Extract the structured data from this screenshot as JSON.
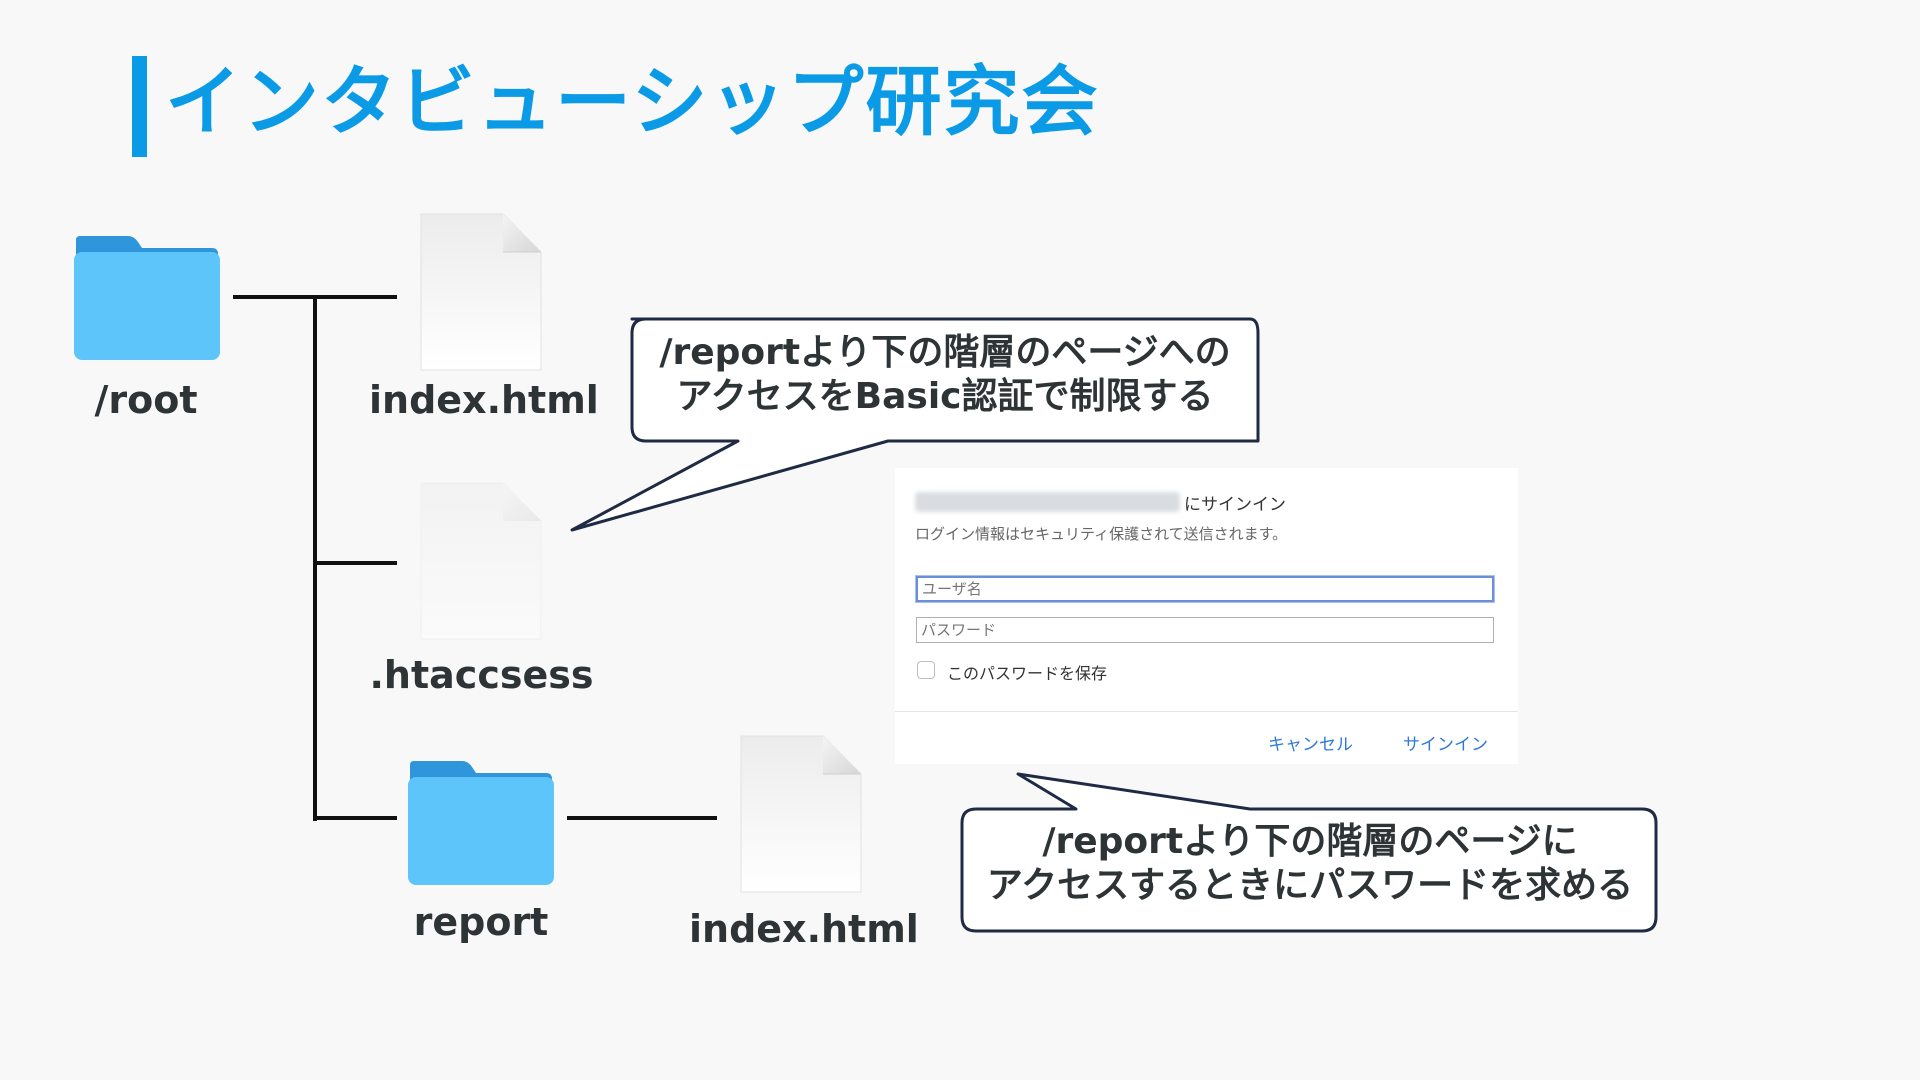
{
  "title": "インタビューシップ研究会",
  "tree": {
    "root_label": "/root",
    "index_label": "index.html",
    "htaccess_label": ".htaccsess",
    "report_label": "report",
    "report_index_label": "index.html"
  },
  "callouts": {
    "top": {
      "line1": "/reportより下の階層のページへの",
      "line2": "アクセスをBasic認証で制限する"
    },
    "bottom": {
      "line1": "/reportより下の階層のページに",
      "line2": "アクセスするときにパスワードを求める"
    }
  },
  "dialog": {
    "title_suffix": "にサインイン",
    "description": "ログイン情報はセキュリティ保護されて送信されます。",
    "username_placeholder": "ユーザ名",
    "password_placeholder": "パスワード",
    "save_label": "このパスワードを保存",
    "cancel_label": "キャンセル",
    "signin_label": "サインイン"
  },
  "colors": {
    "accent": "#0a9ae6",
    "folder_front": "#5ec5fa",
    "folder_back": "#2f96dc",
    "text": "#2e3336",
    "callout_border": "#1f2a44",
    "link": "#2f7ad6"
  }
}
